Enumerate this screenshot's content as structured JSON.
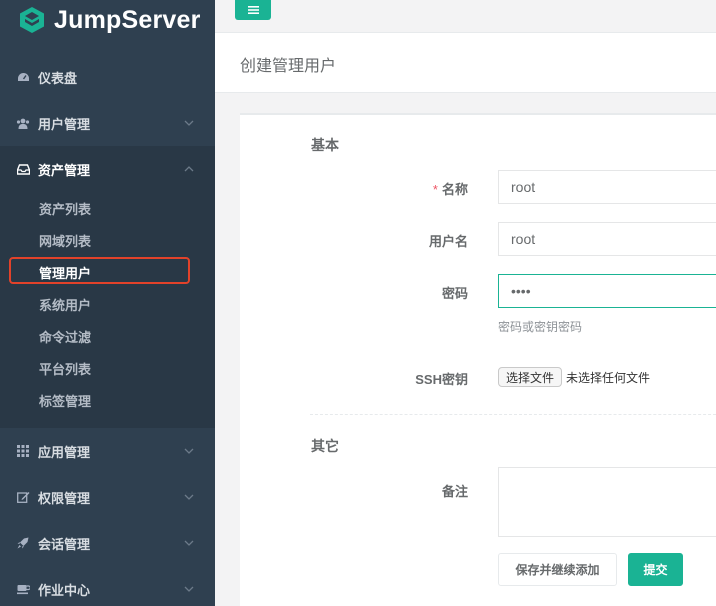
{
  "app": {
    "logo_text": "JumpServer",
    "accent_color": "#1ab394",
    "sidebar_color": "#2f4050"
  },
  "sidebar": {
    "items": [
      {
        "label": "仪表盘",
        "icon": "dashboard-icon"
      },
      {
        "label": "用户管理",
        "icon": "users-icon"
      },
      {
        "label": "资产管理",
        "icon": "inbox-icon",
        "expanded": true
      },
      {
        "label": "应用管理",
        "icon": "grid-icon"
      },
      {
        "label": "权限管理",
        "icon": "edit-icon"
      },
      {
        "label": "会话管理",
        "icon": "rocket-icon"
      },
      {
        "label": "作业中心",
        "icon": "coffee-icon"
      }
    ],
    "asset_submenu": [
      {
        "label": "资产列表"
      },
      {
        "label": "网域列表"
      },
      {
        "label": "管理用户",
        "active": true
      },
      {
        "label": "系统用户"
      },
      {
        "label": "命令过滤"
      },
      {
        "label": "平台列表"
      },
      {
        "label": "标签管理"
      }
    ]
  },
  "topbar": {
    "menu_icon": "hamburger-icon"
  },
  "page": {
    "title": "创建管理用户"
  },
  "form": {
    "basic_section": "基本",
    "name_required_mark": "*",
    "name_label": "名称",
    "name_value": "root",
    "username_label": "用户名",
    "username_value": "root",
    "password_label": "密码",
    "password_value": "root",
    "password_help": "密码或密钥密码",
    "ssh_key_label": "SSH密钥",
    "file_button": "选择文件",
    "file_status": "未选择任何文件",
    "other_section": "其它",
    "comment_label": "备注",
    "comment_value": "",
    "save_continue_button": "保存并继续添加",
    "submit_button": "提交"
  }
}
